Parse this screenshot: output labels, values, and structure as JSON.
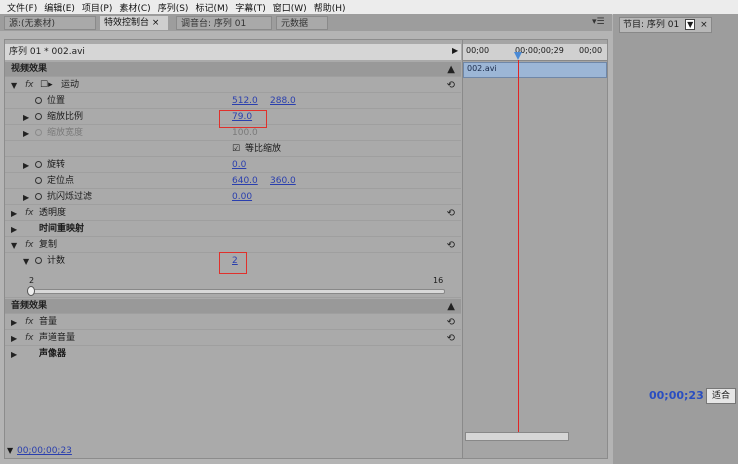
{
  "menu": [
    "文件(F)",
    "编辑(E)",
    "项目(P)",
    "素材(C)",
    "序列(S)",
    "标记(M)",
    "字幕(T)",
    "窗口(W)",
    "帮助(H)"
  ],
  "tabs": {
    "source": "源:(无素材)",
    "effect_controls": "特效控制台 ×",
    "mixer": "调音台: 序列 01",
    "metadata": "元数据"
  },
  "program_tab": "节目: 序列 01",
  "program_tab_close": "×",
  "panel_menu_icon": "▾☰",
  "sequence_clip": "序列 01 * 002.avi",
  "timeline": {
    "t0": "00;00",
    "t1": "00;00;00;29",
    "t2": "00;00",
    "clip": "002.avi"
  },
  "video_effects": {
    "header": "视频效果",
    "motion": {
      "label": "运动",
      "position": {
        "label": "位置",
        "x": "512.0",
        "y": "288.0"
      },
      "scale": {
        "label": "缩放比例",
        "value": "79.0"
      },
      "scale_width": {
        "label": "缩放宽度",
        "value": "100.0"
      },
      "uniform": {
        "label": "等比缩放",
        "checked": true
      },
      "rotation": {
        "label": "旋转",
        "value": "0.0"
      },
      "anchor": {
        "label": "定位点",
        "x": "640.0",
        "y": "360.0"
      },
      "antiflicker": {
        "label": "抗闪烁过滤",
        "value": "0.00"
      }
    },
    "opacity": "透明度",
    "time_remap": "时间重映射",
    "replicate": {
      "label": "复制",
      "count": {
        "label": "计数",
        "value": "2"
      },
      "slider_min": "2",
      "slider_max": "16"
    }
  },
  "audio_effects": {
    "header": "音频效果",
    "volume": "音量",
    "channel_volume": "声道音量",
    "panner": "声像器"
  },
  "current_time": "00;00;00;23",
  "program_time": "00;00;23",
  "fit": "适合",
  "reset_icon": "⟲"
}
